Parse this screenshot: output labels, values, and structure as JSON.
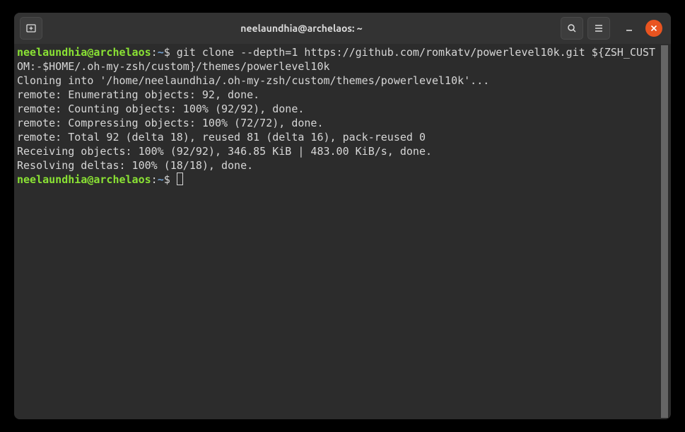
{
  "titlebar": {
    "title": "neelaundhia@archelaos: ~"
  },
  "prompt": {
    "user_host": "neelaundhia@archelaos",
    "colon": ":",
    "path": "~",
    "dollar": "$"
  },
  "command": " git clone --depth=1 https://github.com/romkatv/powerlevel10k.git ${ZSH_CUSTOM:-$HOME/.oh-my-zsh/custom}/themes/powerlevel10k",
  "output": {
    "line1": "Cloning into '/home/neelaundhia/.oh-my-zsh/custom/themes/powerlevel10k'...",
    "line2": "remote: Enumerating objects: 92, done.",
    "line3": "remote: Counting objects: 100% (92/92), done.",
    "line4": "remote: Compressing objects: 100% (72/72), done.",
    "line5": "remote: Total 92 (delta 18), reused 81 (delta 16), pack-reused 0",
    "line6": "Receiving objects: 100% (92/92), 346.85 KiB | 483.00 KiB/s, done.",
    "line7": "Resolving deltas: 100% (18/18), done."
  }
}
